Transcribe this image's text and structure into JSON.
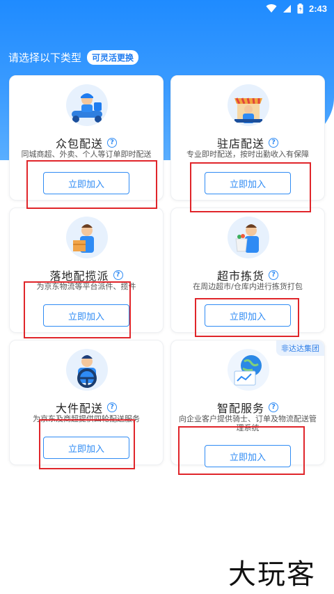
{
  "status_bar": {
    "time": "2:43"
  },
  "heading": "请选择以下类型",
  "flex_badge": "可灵活更换",
  "cards": [
    {
      "title": "众包配送",
      "desc": "同城商超、外卖、个人等订单即时配送",
      "button": "立即加入"
    },
    {
      "title": "驻店配送",
      "desc": "专业即时配送，按时出勤收入有保障",
      "button": "立即加入"
    },
    {
      "title": "落地配揽派",
      "desc": "为京东物流等平台派件、揽件",
      "button": "立即加入"
    },
    {
      "title": "超市拣货",
      "desc": "在周边超市/仓库内进行拣货打包",
      "button": "立即加入"
    },
    {
      "title": "大件配送",
      "desc": "为京东及商超提供四轮配送服务",
      "button": "立即加入"
    },
    {
      "title": "智配服务",
      "desc": "向企业客户提供骑士、订单及物流配送管理系统",
      "button": "立即加入",
      "tag": "非达达集团"
    }
  ],
  "watermark": "大玩客",
  "colors": {
    "primary": "#2f8bf4",
    "highlight_box": "#e0252a",
    "hero": "#1f8bff"
  }
}
